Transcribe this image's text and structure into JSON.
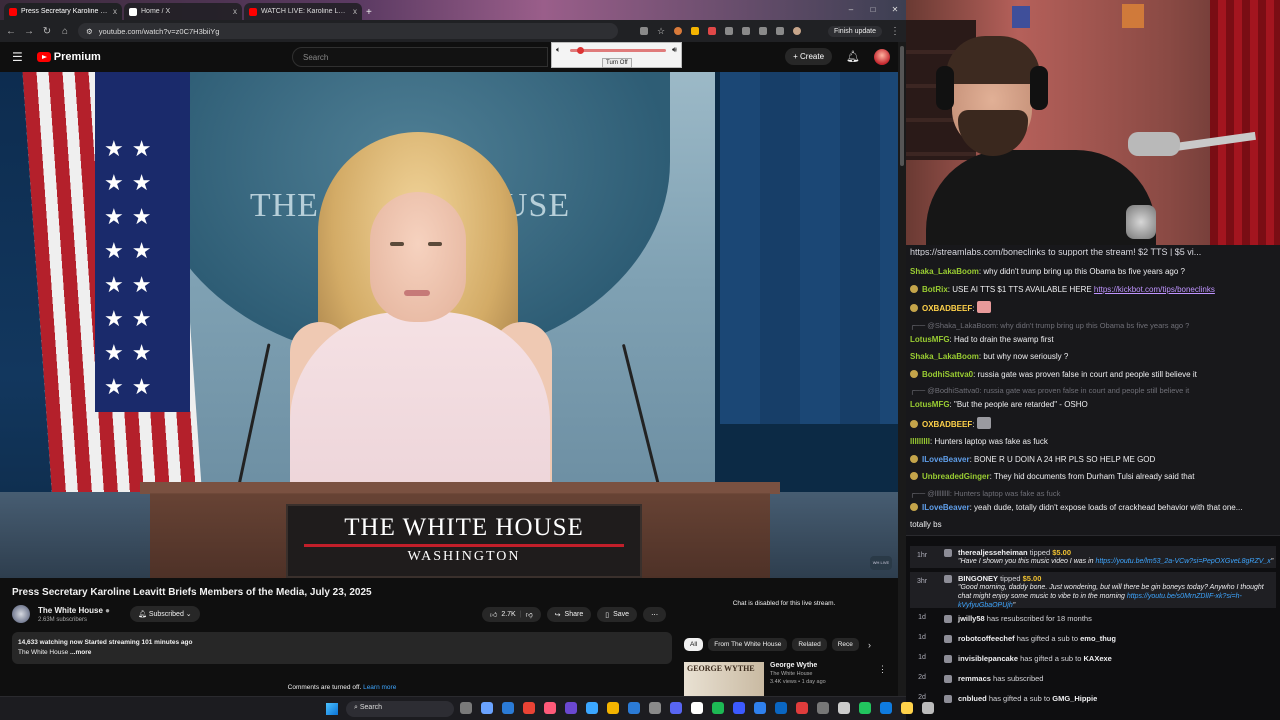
{
  "browser": {
    "tabs": [
      {
        "title": "Press Secretary Karoline Leavitt Briefs",
        "close": "x",
        "color": "#ff0000"
      },
      {
        "title": "Home / X",
        "close": "x",
        "color": "#ffffff"
      },
      {
        "title": "WATCH LIVE: Karoline Leavitt Is",
        "close": "x",
        "color": "#ff0000"
      }
    ],
    "new_tab": "+",
    "url": "youtube.com/watch?v=z0C7H3biiYg",
    "finish_update": "Finish update",
    "window_controls": [
      "–",
      "□",
      "✕"
    ]
  },
  "volume_popup": {
    "turn_off_label": "Turn Off",
    "level": 0.07
  },
  "youtube": {
    "logo_text": "Premium",
    "search_placeholder": "Search",
    "create_label": "Create",
    "video": {
      "wall_text": "THE WHITE HOUSE",
      "plaque_line1": "THE WHITE HOUSE",
      "plaque_line2": "WASHINGTON",
      "bug_text": "WH LIVE"
    },
    "title": "Press Secretary Karoline Leavitt Briefs Members of the Media, July 23, 2025",
    "channel": {
      "name": "The White House",
      "subscribers": "2.63M subscribers",
      "subscribed_label": "Subscribed"
    },
    "actions": {
      "likes": "2.7K",
      "share": "Share",
      "save": "Save"
    },
    "description": {
      "stats": "14,633 watching now  Started streaming 101 minutes ago",
      "text": "The White House",
      "more": "...more"
    },
    "comments_off": "Comments are turned off.",
    "learn_more": "Learn more",
    "chat_disabled": "Chat is disabled for this live stream.",
    "chips": [
      "All",
      "From The White House",
      "Related",
      "Rece"
    ],
    "recommendation": {
      "thumb_text": "GEORGE WYTHE",
      "title": "George Wythe",
      "channel": "The White House",
      "meta": "3.4K views • 1 day ago"
    }
  },
  "chat": {
    "pinned": {
      "link": "https://streamlabs.com/boneclinks",
      "text": " to support the stream! $2 TTS | $5 vi..."
    },
    "messages": [
      {
        "type": "msg",
        "user": "Shaka_LakaBoom",
        "color": "#9acd32",
        "text": "why didn't trump bring up this Obama bs five years ago ?"
      },
      {
        "type": "msg",
        "user": "BotRix",
        "color": "#9acd32",
        "badge": true,
        "text": "USE AI TTS $1 TTS AVAILABLE HERE ",
        "link": "https://kickbot.com/tips/boneclinks"
      },
      {
        "type": "msg",
        "user": "OXBADBEEF",
        "color": "#ffd24a",
        "badge": true,
        "emote": "#e89a9a",
        "text": ""
      },
      {
        "type": "reply",
        "text": "@Shaka_LakaBoom: why didn't trump bring up this Obama bs five years ago ?"
      },
      {
        "type": "msg",
        "user": "LotusMFG",
        "color": "#9acd32",
        "text": "Had to drain the swamp first"
      },
      {
        "type": "msg",
        "user": "Shaka_LakaBoom",
        "color": "#9acd32",
        "text": "but why now seriously ?"
      },
      {
        "type": "msg",
        "user": "BodhiSattva0",
        "color": "#9acd32",
        "badge": true,
        "text": "russia gate was proven false in court and people still believe it"
      },
      {
        "type": "reply",
        "text": "@BodhiSattva0: russia gate was proven false in court and people still believe it"
      },
      {
        "type": "msg",
        "user": "LotusMFG",
        "color": "#9acd32",
        "text": "\"But the people are retarded\" - OSHO"
      },
      {
        "type": "msg",
        "user": "OXBADBEEF",
        "color": "#ffd24a",
        "badge": true,
        "emote": "#9a9aa0",
        "text": ""
      },
      {
        "type": "msg",
        "user": "lllllllll",
        "color": "#9acd32",
        "text": "Hunters laptop was fake as fuck"
      },
      {
        "type": "msg",
        "user": "ILoveBeaver",
        "color": "#5f9eea",
        "badge": true,
        "text": "BONE R U DOIN A 24 HR PLS SO HELP ME GOD"
      },
      {
        "type": "msg",
        "user": "UnbreadedGinger",
        "color": "#9acd32",
        "badge": true,
        "text": "They hid documents from Durham Tulsi already said that"
      },
      {
        "type": "reply",
        "text": "@lllllllll: Hunters laptop was fake as fuck"
      },
      {
        "type": "msg",
        "user": "ILoveBeaver",
        "color": "#5f9eea",
        "badge": true,
        "text": "yeah dude, totally didn't expose loads of crackhead behavior with that one..."
      },
      {
        "type": "cont",
        "text": "totally bs"
      }
    ]
  },
  "feed": [
    {
      "age": "1hr",
      "user": "therealjesseheiman",
      "action": " tipped ",
      "amount": "$5.00",
      "message": "\"Have I shown you this music video I was in ",
      "link": "https://youtu.be/lm53_2a-VCw?si=PepOXGveL8gRZV_x",
      "tail": "\""
    },
    {
      "age": "3hr",
      "user": "BINGONEY",
      "action": " tipped ",
      "amount": "$5.00",
      "message": "\"Good morning, daddy bone. Just wondering, but will there be gin boneys today? Anywho I thought chat might enjoy some music to vibe to in the morning ",
      "link": "https://youtu.be/s0MrnZDlIF-xk?si=h-kVyfyuGbaOPUjh",
      "tail": "\""
    },
    {
      "age": "1d",
      "user": "jwilly58",
      "action": " has resubscribed for 18 months"
    },
    {
      "age": "1d",
      "user": "robotcoffeechef",
      "action": " has gifted a sub to ",
      "target": "emo_thug"
    },
    {
      "age": "1d",
      "user": "invisiblepancake",
      "action": " has gifted a sub to ",
      "target": "KAXexe"
    },
    {
      "age": "2d",
      "user": "remmacs",
      "action": " has subscribed"
    },
    {
      "age": "2d",
      "user": "cnblued",
      "action": " has gifted a sub to ",
      "target": "GMG_Hippie"
    }
  ],
  "taskbar": {
    "search_label": "Search",
    "icon_colors": [
      "#7a7a7a",
      "#6aa3ff",
      "#2b7bd6",
      "#ea4335",
      "#ff5a79",
      "#6b48d1",
      "#3ba7ff",
      "#f4b400",
      "#2b7bd6",
      "#8a8a8a",
      "#5865f2",
      "#ffffff",
      "#1db954",
      "#3c5aff",
      "#2f80ed",
      "#0a66c2",
      "#e03c3c",
      "#777777",
      "#cccccc",
      "#22c55e",
      "#0f7bdf",
      "#ffd24a",
      "#bbbbbb"
    ]
  }
}
